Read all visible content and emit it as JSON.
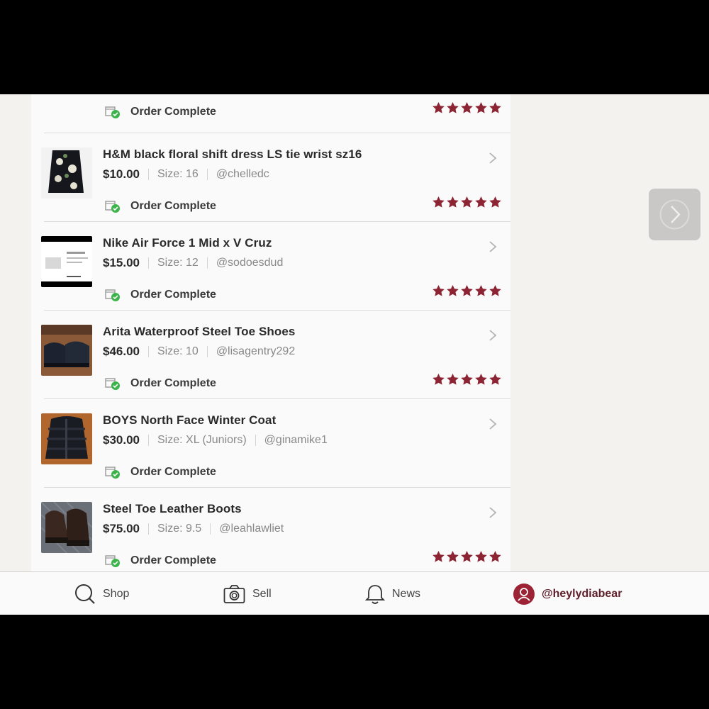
{
  "colors": {
    "star": "#8c2433",
    "accent": "#9b2335",
    "check": "#3cb44b"
  },
  "orders": [
    {
      "title": "",
      "price": "",
      "size": "",
      "seller": "",
      "status": "Order Complete",
      "rating": 5,
      "thumb": "boots-brown"
    },
    {
      "title": "H&M black floral shift dress LS tie wrist sz16",
      "price": "$10.00",
      "size": "Size: 16",
      "seller": "@chelledc",
      "status": "Order Complete",
      "rating": 5,
      "thumb": "floral-dress"
    },
    {
      "title": "Nike Air Force 1 Mid x V Cruz",
      "price": "$15.00",
      "size": "Size: 12",
      "seller": "@sodoesdud",
      "status": "Order Complete",
      "rating": 5,
      "thumb": "sneaker-screenshot"
    },
    {
      "title": "Arita Waterproof Steel Toe Shoes",
      "price": "$46.00",
      "size": "Size: 10",
      "seller": "@lisagentry292",
      "status": "Order Complete",
      "rating": 5,
      "thumb": "work-shoes"
    },
    {
      "title": "BOYS North Face Winter Coat",
      "price": "$30.00",
      "size": "Size: XL (Juniors)",
      "seller": "@ginamike1",
      "status": "Order Complete",
      "rating": 0,
      "thumb": "puffer-coat"
    },
    {
      "title": "Steel Toe Leather Boots",
      "price": "$75.00",
      "size": "Size: 9.5",
      "seller": "@leahlawliet",
      "status": "Order Complete",
      "rating": 5,
      "thumb": "leather-boots"
    }
  ],
  "tabbar": {
    "shop": "Shop",
    "sell": "Sell",
    "news": "News",
    "profile": "@heylydiabear"
  },
  "icons": {
    "next": "chevron-right-circle-icon",
    "shop": "search-icon",
    "sell": "camera-icon",
    "news": "bell-icon",
    "profile": "user-avatar-icon"
  }
}
